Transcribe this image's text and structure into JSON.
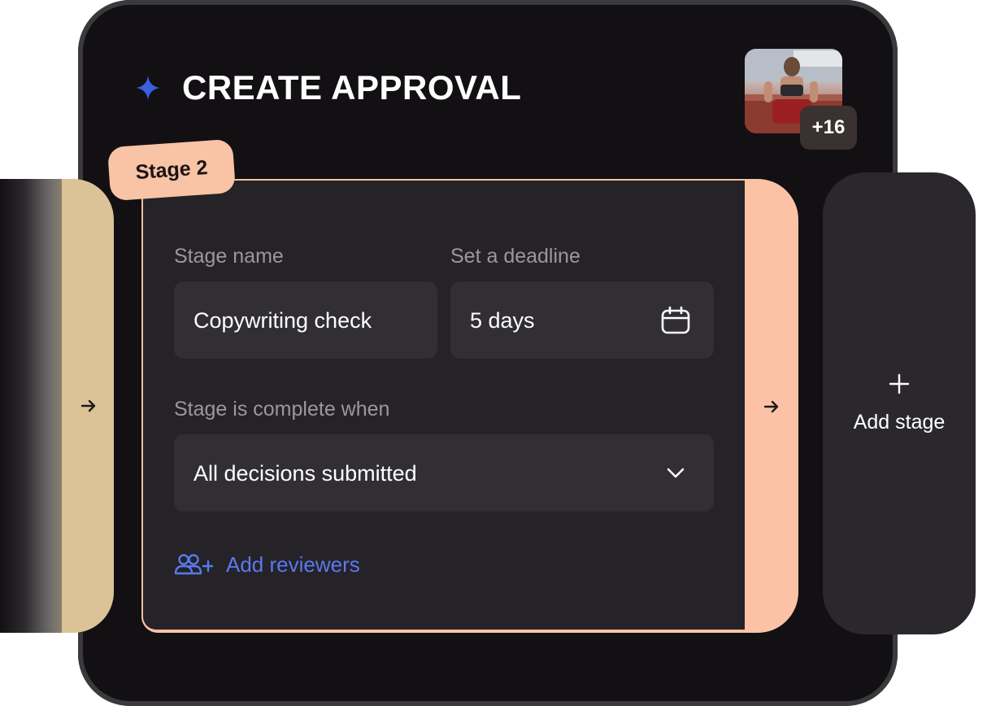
{
  "header": {
    "title": "CREATE APPROVAL",
    "sparkle_icon": "sparkle-icon",
    "accent_color": "#3a5fe0"
  },
  "participants": {
    "extra_count": "+16"
  },
  "stage": {
    "tag": "Stage 2",
    "name_label": "Stage name",
    "name_value": "Copywriting check",
    "deadline_label": "Set a deadline",
    "deadline_value": "5 days",
    "completion_label": "Stage is complete when",
    "completion_value": "All decisions submitted",
    "add_reviewers_label": "Add reviewers",
    "card_color": "#fcc2a6"
  },
  "previous_stage": {
    "color": "#dcc297"
  },
  "add_stage": {
    "label": "Add stage"
  }
}
